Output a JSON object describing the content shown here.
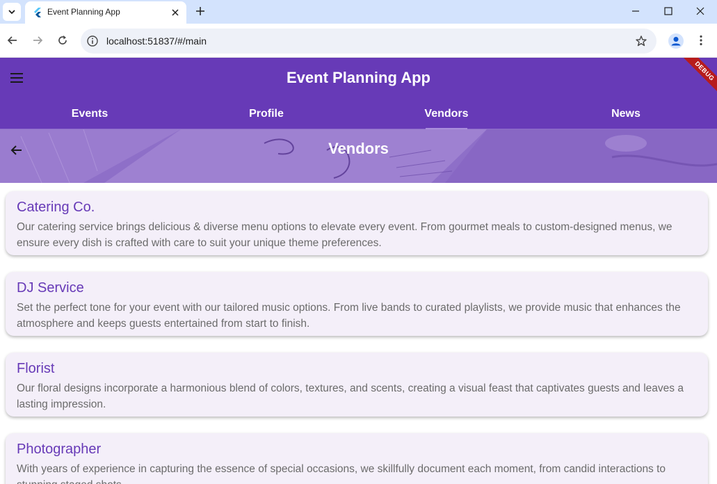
{
  "browser": {
    "tab_title": "Event Planning App",
    "url": "localhost:51837/#/main"
  },
  "app": {
    "title": "Event Planning App",
    "debug_label": "DEBUG",
    "tabs": [
      {
        "label": "Events"
      },
      {
        "label": "Profile"
      },
      {
        "label": "Vendors"
      },
      {
        "label": "News"
      }
    ],
    "selected_tab": "Vendors",
    "page_title": "Vendors",
    "vendors": [
      {
        "name": "Catering Co.",
        "description": "Our catering service brings delicious & diverse menu options to elevate every event. From gourmet meals to custom-designed menus, we ensure every dish is crafted with care to suit your unique theme preferences."
      },
      {
        "name": "DJ Service",
        "description": "Set the perfect tone for your event with our tailored music options. From live bands to curated playlists, we provide music that enhances the atmosphere and keeps guests entertained from start to finish."
      },
      {
        "name": "Florist",
        "description": "Our floral designs incorporate a harmonious blend of colors, textures, and scents, creating a visual feast that captivates guests and leaves a lasting impression."
      },
      {
        "name": "Photographer",
        "description": "With years of experience in capturing the essence of special occasions, we skillfully document each moment, from candid interactions to stunning staged shots."
      }
    ]
  },
  "colors": {
    "primary": "#673ab7",
    "card_background": "#f4eff9",
    "debug_banner": "#b71c1c",
    "browser_tabstrip": "#d3e3fd"
  },
  "icons": {
    "menu": "menu-icon",
    "back": "arrow-back-icon",
    "browser_back": "arrow-back-icon",
    "forward": "arrow-forward-icon",
    "reload": "reload-icon",
    "site_info": "info-icon",
    "bookmark": "star-icon",
    "profile": "profile-icon",
    "more": "kebab-menu-icon"
  }
}
